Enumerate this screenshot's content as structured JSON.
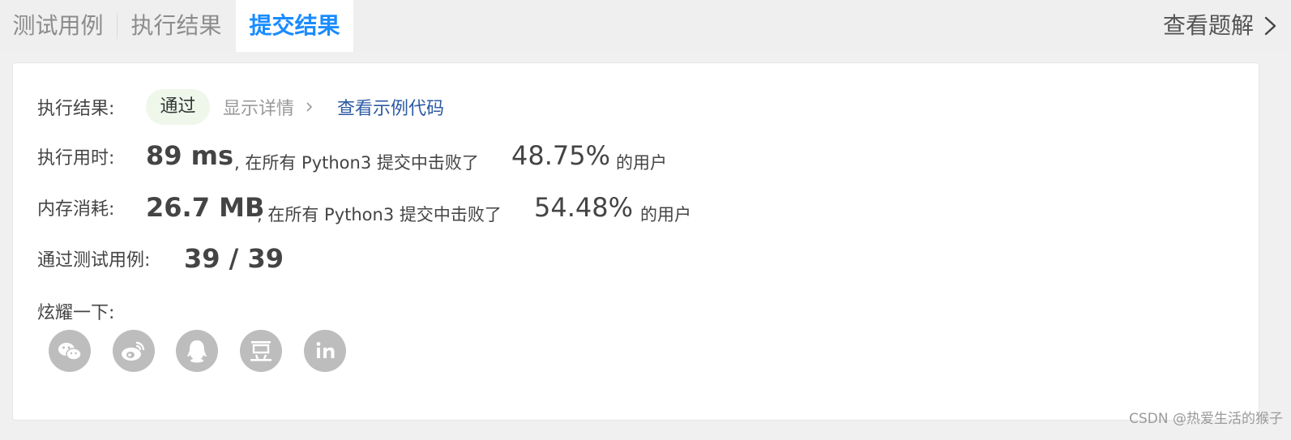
{
  "tabs": [
    {
      "label": "测试用例"
    },
    {
      "label": "执行结果"
    },
    {
      "label": "提交结果"
    }
  ],
  "solution_link": "查看题解",
  "result": {
    "label": "执行结果:",
    "status": "通过",
    "details_link": "显示详情",
    "sample_code_link": "查看示例代码"
  },
  "runtime": {
    "label": "执行用时:",
    "value": "89 ms",
    "text": ", 在所有 Python3 提交中击败了",
    "percent": "48.75%",
    "suffix": "的用户"
  },
  "memory": {
    "label": "内存消耗:",
    "value": "26.7 MB",
    "text": ", 在所有 Python3 提交中击败了",
    "percent": "54.48%",
    "suffix": "的用户"
  },
  "testcases": {
    "label": "通过测试用例:",
    "value": "39 / 39"
  },
  "share": {
    "label": "炫耀一下:",
    "icons": [
      "wechat-icon",
      "weibo-icon",
      "qq-icon",
      "douban-icon",
      "linkedin-icon"
    ]
  },
  "colors": {
    "accent": "#1a8cff",
    "link": "#2d5aa3",
    "badge_bg": "#eef7ea",
    "icon_bg": "#bdbdbd"
  },
  "watermark": "CSDN @热爱生活的猴子"
}
